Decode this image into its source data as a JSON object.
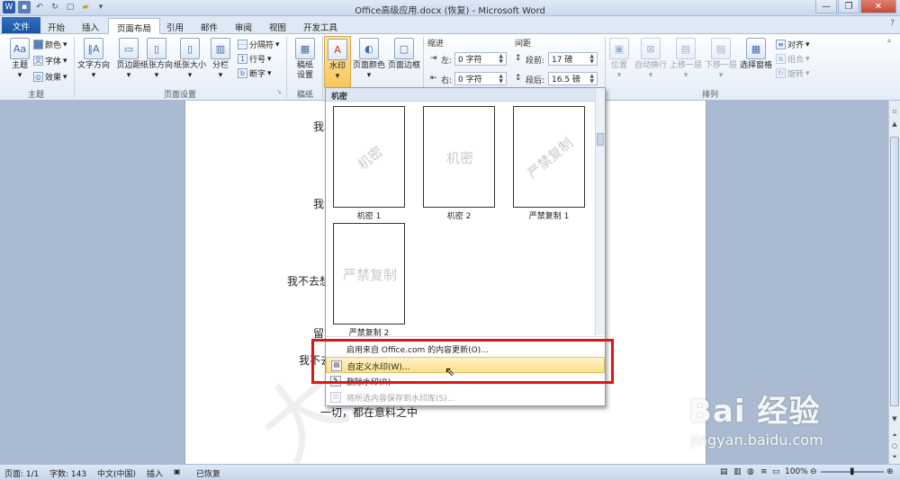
{
  "window": {
    "title": "Office高级应用.docx (恢复) - Microsoft Word",
    "min_icon": "minimize-icon",
    "max_icon": "maximize-icon",
    "close_icon": "close-icon",
    "help": "?"
  },
  "tabs": [
    "文件",
    "开始",
    "插入",
    "页面布局",
    "引用",
    "邮件",
    "审阅",
    "视图",
    "开发工具"
  ],
  "active_tab": "页面布局",
  "ribbon": {
    "theme": {
      "big": "主题",
      "colors": "颜色",
      "fonts": "字体",
      "effects": "效果",
      "group": "主题"
    },
    "page_setup": {
      "text_direction": "文字方向",
      "margins": "页边距",
      "orientation": "纸张方向",
      "size": "纸张大小",
      "columns": "分栏",
      "breaks": "分隔符",
      "line_numbers": "行号",
      "hyphenation": "断字",
      "group": "页面设置"
    },
    "draft": {
      "label1": "稿纸",
      "label2": "设置",
      "group": "稿纸"
    },
    "page_background": {
      "watermark": "水印",
      "page_color": "页面颜色",
      "page_border": "页面边框"
    },
    "indent": {
      "title": "缩进",
      "left_label": "左:",
      "left_value": "0 字符",
      "right_label": "右:",
      "right_value": "0 字符"
    },
    "spacing": {
      "title": "间距",
      "before_label": "段前:",
      "before_value": "17 磅",
      "after_label": "段后:",
      "after_value": "16.5 磅"
    },
    "arrange": {
      "position": "位置",
      "wrap": "自动换行",
      "bring_forward": "上移一层",
      "send_backward": "下移一层",
      "selection_pane": "选择窗格",
      "align": "对齐",
      "group_btn": "组合",
      "rotate": "旋转",
      "group": "排列"
    }
  },
  "document": {
    "lines": [
      "我",
      "我",
      "我不去想",
      "留",
      "我不去",
      "一切，都在意料之中"
    ]
  },
  "gallery": {
    "header": "机密",
    "items": [
      {
        "label": "机密 1",
        "text": "机密"
      },
      {
        "label": "机密 2",
        "text": "机密"
      },
      {
        "label": "严禁复制 1",
        "text": "严禁复制"
      },
      {
        "label": "严禁复制 2",
        "text": "严禁复制"
      }
    ],
    "menu": [
      {
        "label": "启用来自 Office.com 的内容更新(O)...",
        "enabled": true
      },
      {
        "label": "自定义水印(W)...",
        "enabled": true,
        "highlighted": true
      },
      {
        "label": "删除水印(R)",
        "enabled": true
      },
      {
        "label": "将所选内容保存到水印库(S)...",
        "enabled": false
      }
    ]
  },
  "statusbar": {
    "page": "页面: 1/1",
    "words": "字数: 143",
    "language": "中文(中国)",
    "insert": "插入",
    "recovered": "已恢复",
    "zoom": "100%"
  },
  "overlay": {
    "brand": "Bai 经验",
    "url": "jingyan.baidu.com"
  },
  "colors": {
    "accent": "#2f6fc1",
    "highlight": "#fbdf8a",
    "red_box": "#e01414"
  }
}
